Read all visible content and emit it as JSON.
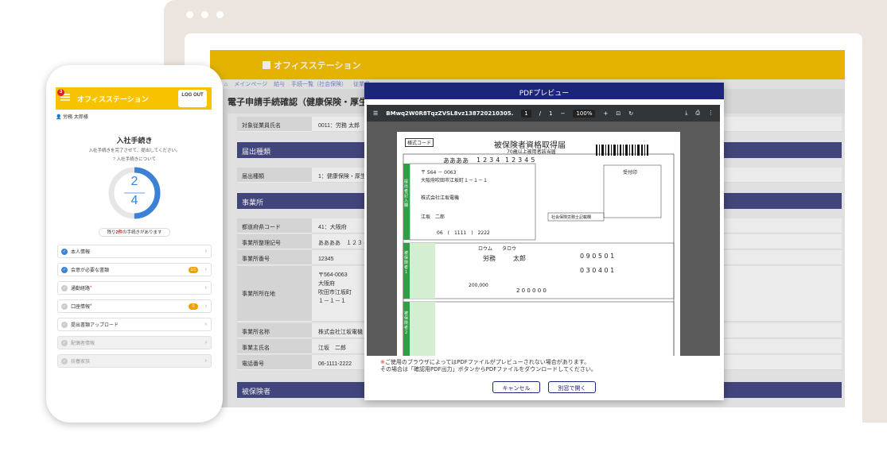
{
  "desktop": {
    "brand": "オフィスステーション",
    "breadcrumbs": [
      "メインページ",
      "給与",
      "手続一覧（社会保険）",
      "従業員..."
    ],
    "page_title": "電子申請手続確認（健康保険・厚生年金",
    "sections": {
      "employee_label": "対象従業員氏名",
      "employee_value": "0011：労務 太郎",
      "filing_type_header": "届出種類",
      "filing_type_label": "届出種類",
      "filing_type_value": "1：健康保険・厚生",
      "office_header": "事業所",
      "insured_header": "被保険者"
    },
    "office_rows": [
      {
        "label": "都道府県コード",
        "value": "41：大阪府"
      },
      {
        "label": "事業所整理記号",
        "value": "ああああ　１２３４"
      },
      {
        "label": "事業所番号",
        "value": "12345"
      },
      {
        "label": "事業所所在地",
        "value": "〒564-0063\n大阪府\n吹田市江坂町\n１－１－１"
      },
      {
        "label": "事業所名称",
        "value": "株式会社江坂電機"
      },
      {
        "label": "事業主氏名",
        "value": "江坂　二郎"
      },
      {
        "label": "電話番号",
        "value": "06-1111-2222"
      }
    ]
  },
  "modal": {
    "title": "PDFプレビュー",
    "filename": "BMwq2W0R8TqzZVSL8vz138720210305...",
    "page_current": "1",
    "page_total": "1",
    "zoom": "100%",
    "note_line1": "ご使用のブラウザによってはPDFファイルがプレビューされない場合があります。",
    "note_line2": "その場合は「確認用PDF出力」ボタンからPDFファイルをダウンロードしてください。",
    "cancel_label": "キャンセル",
    "open_label": "別窓で開く",
    "form": {
      "title": "被保険者資格取得届",
      "subtitle": "70歳以上被用者該当届",
      "form_code": "様式コード",
      "office_code": "ああああ",
      "office_num": "1234",
      "office_num2": "12345",
      "postal": "〒 564 － 0063",
      "address": "大阪府吹田市江坂町１－１－１",
      "company": "株式会社江坂電機",
      "owner": "江坂　二郎",
      "phone": "06　(　1111　)　2222",
      "receipt": "受付印",
      "furigana": "ロウム　　タロウ",
      "name_last": "労務",
      "name_first": "太郎",
      "birth": "0 9 0 5 0 1",
      "acq_date": "0 3 0 4 0 1",
      "salary": "200,000",
      "salary_total": "2 0 0 0 0 0",
      "side1": "提出者記入欄",
      "side2": "被保険者１",
      "side3": "被保険者２",
      "sr_label": "社会保険労務士記載欄"
    }
  },
  "phone": {
    "brand": "オフィスステーション",
    "notification_count": "3",
    "logout_label": "LOG OUT",
    "user": "労務 太郎様",
    "title": "入社手続き",
    "subtitle": "入社手続きを完了させて、提出してください。",
    "help_link": "入社手続きについて",
    "progress_done": "2",
    "progress_total": "4",
    "progress_fraction": 0.5,
    "remaining_prefix": "残り",
    "remaining_count": "2件",
    "remaining_suffix": "の手続きがあります",
    "items": [
      {
        "label": "本人情報",
        "done": true
      },
      {
        "label": "会意が必要な書類",
        "done": true,
        "badge": "1/1"
      },
      {
        "label": "通勤経路",
        "done": false,
        "required": "*"
      },
      {
        "label": "口座情報",
        "done": false,
        "required": "*",
        "badge": "0"
      },
      {
        "label": "提出書類アップロード",
        "done": false
      },
      {
        "label": "配偶者情報",
        "done": false,
        "disabled": true
      },
      {
        "label": "扶養家族",
        "done": false,
        "disabled": true
      }
    ]
  }
}
